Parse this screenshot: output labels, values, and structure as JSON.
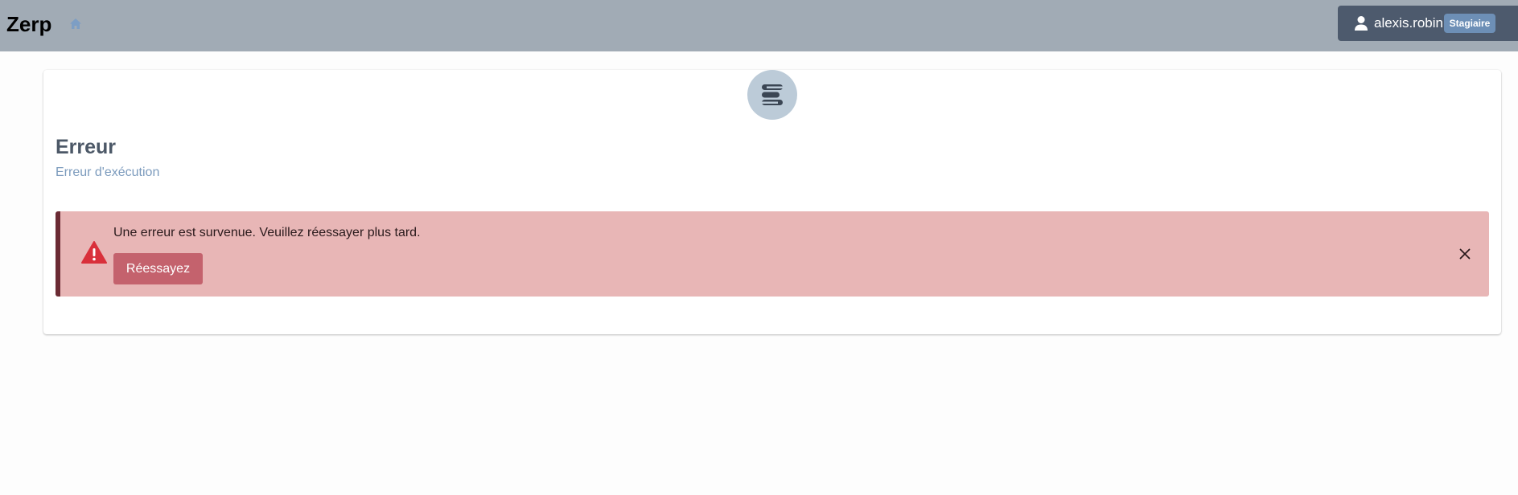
{
  "header": {
    "brand": "Zerp",
    "home_icon": "home-icon",
    "user": {
      "icon": "user-icon",
      "name": "alexis.robin",
      "role": "Stagiaire"
    }
  },
  "card": {
    "logo_icon": "app-logo",
    "title": "Erreur",
    "subtitle": "Erreur d'exécution",
    "alert": {
      "icon": "warning-icon",
      "message": "Une erreur est survenue. Veuillez réessayer plus tard.",
      "retry_label": "Réessayez",
      "close_icon": "close-icon"
    }
  },
  "colors": {
    "topbar_bg": "#a1abb5",
    "user_menu_bg": "#4d5a6d",
    "role_badge_bg": "#6d8fb6",
    "alert_bg": "#e8b6b6",
    "alert_border": "#6b2b34",
    "retry_button_bg": "#c4626d",
    "warning_icon": "#d9303b",
    "subtitle_text": "#7c9bbd"
  }
}
